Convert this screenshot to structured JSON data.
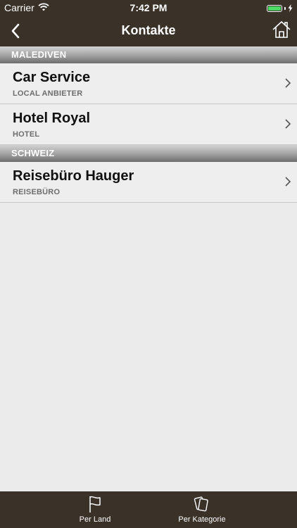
{
  "status": {
    "carrier": "Carrier",
    "time": "7:42 PM",
    "battery_level": 1.0,
    "battery_color": "#4cd964"
  },
  "nav": {
    "title": "Kontakte",
    "back_icon": "chevron-left-icon",
    "home_icon": "home-icon"
  },
  "sections": [
    {
      "header": "MALEDIVEN",
      "rows": [
        {
          "title": "Car Service",
          "subtitle": "LOCAL ANBIETER"
        },
        {
          "title": "Hotel Royal",
          "subtitle": "HOTEL"
        }
      ]
    },
    {
      "header": "SCHWEIZ",
      "rows": [
        {
          "title": "Reisebüro Hauger",
          "subtitle": "REISEBÜRO"
        }
      ]
    }
  ],
  "tabs": [
    {
      "label": "Per Land",
      "icon": "flag-icon"
    },
    {
      "label": "Per Kategorie",
      "icon": "cards-icon"
    }
  ],
  "colors": {
    "bar_background": "#3a3129",
    "list_background": "#ebebeb"
  }
}
